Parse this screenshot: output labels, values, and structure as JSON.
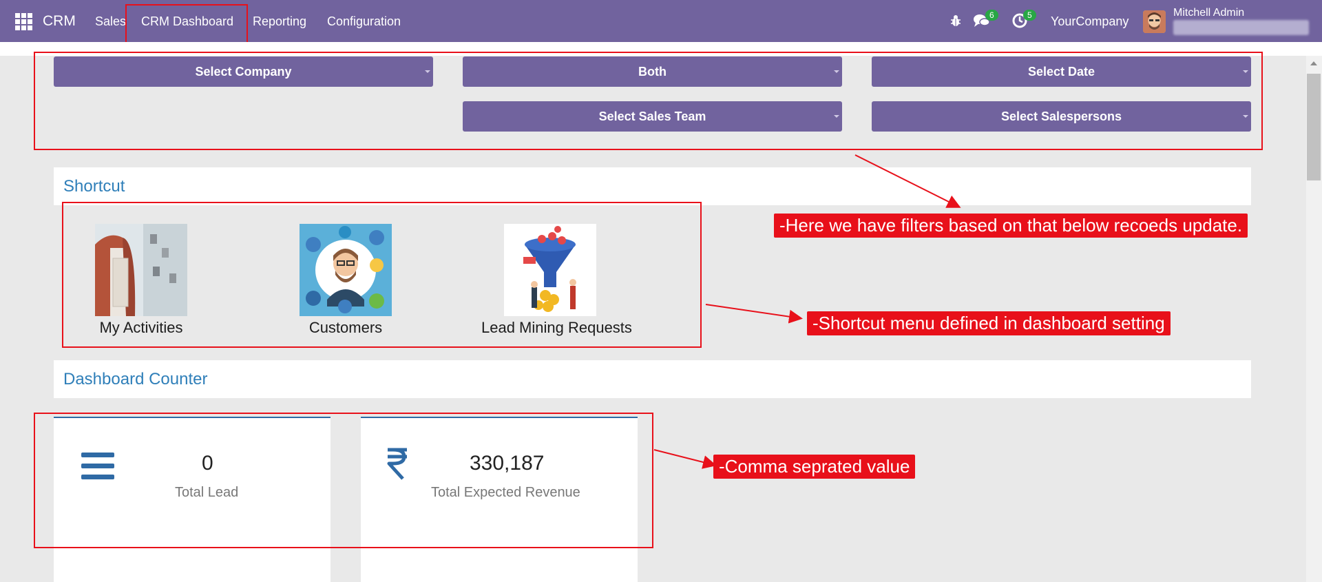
{
  "navbar": {
    "brand": "CRM",
    "menu": [
      "Sales",
      "CRM Dashboard",
      "Reporting",
      "Configuration"
    ],
    "messages_badge": "6",
    "activities_badge": "5",
    "company": "YourCompany",
    "user_name": "Mitchell Admin"
  },
  "filters": {
    "company": "Select Company",
    "type": "Both",
    "date": "Select Date",
    "sales_team": "Select Sales Team",
    "salespersons": "Select Salespersons"
  },
  "shortcut_section": {
    "title": "Shortcut",
    "items": [
      {
        "label": "My Activities",
        "icon": "activities-photo"
      },
      {
        "label": "Customers",
        "icon": "customers-illustration"
      },
      {
        "label": "Lead Mining Requests",
        "icon": "lead-mining-funnel"
      }
    ]
  },
  "counter_section": {
    "title": "Dashboard Counter",
    "cards": [
      {
        "value": "0",
        "label": "Total Lead",
        "icon": "bars-icon"
      },
      {
        "value": "330,187",
        "label": "Total Expected Revenue",
        "icon": "rupee-icon"
      }
    ]
  },
  "annotations": {
    "filters_note": "-Here we have filters based on that below recoeds update.",
    "shortcut_note": "-Shortcut menu defined in dashboard setting",
    "counter_note": "-Comma seprated value"
  },
  "colors": {
    "navbar": "#71639e",
    "accent_blue": "#2f7fb9",
    "annotation_red": "#e8101a",
    "badge_green": "#28a745"
  }
}
